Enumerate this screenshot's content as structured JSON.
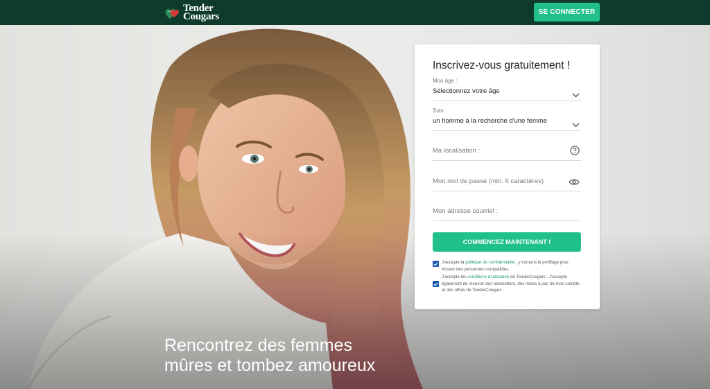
{
  "header": {
    "logo_line1": "Tender",
    "logo_line2": "Cougars",
    "login_button": "SE CONNECTER"
  },
  "hero": {
    "headline_line1": "Rencontrez des femmes",
    "headline_line2": "mûres et tombez amoureux"
  },
  "signup": {
    "title": "Inscrivez-vous gratuitement !",
    "age": {
      "label": "Mon âge :",
      "value": "Sélectionnez votre âge"
    },
    "status": {
      "label": "Suis:",
      "value": "un homme à la recherche d'une femme"
    },
    "location": {
      "placeholder": "Ma localisation :"
    },
    "password": {
      "placeholder": "Mon mot de passe (min. 6 caractères)"
    },
    "email": {
      "placeholder": "Mon adresse courriel :"
    },
    "submit": "COMMENCEZ MAINTENANT !",
    "consent1": {
      "before": "J'accepte la ",
      "link": "politique de confidentialité",
      "after": " , y compris le profilage pour trouver des personnes compatibles."
    },
    "consent2": {
      "before": "J'accepte les ",
      "link": "conditions d'utilisation",
      "after": " de TenderCougars . J'accepte également de recevoir des newsletters, des mises à jour de mon compte et des offres de TenderCougars ."
    }
  },
  "colors": {
    "header_bg": "#0e3b2c",
    "accent": "#1fc08a",
    "checkbox": "#1a5aa8"
  }
}
